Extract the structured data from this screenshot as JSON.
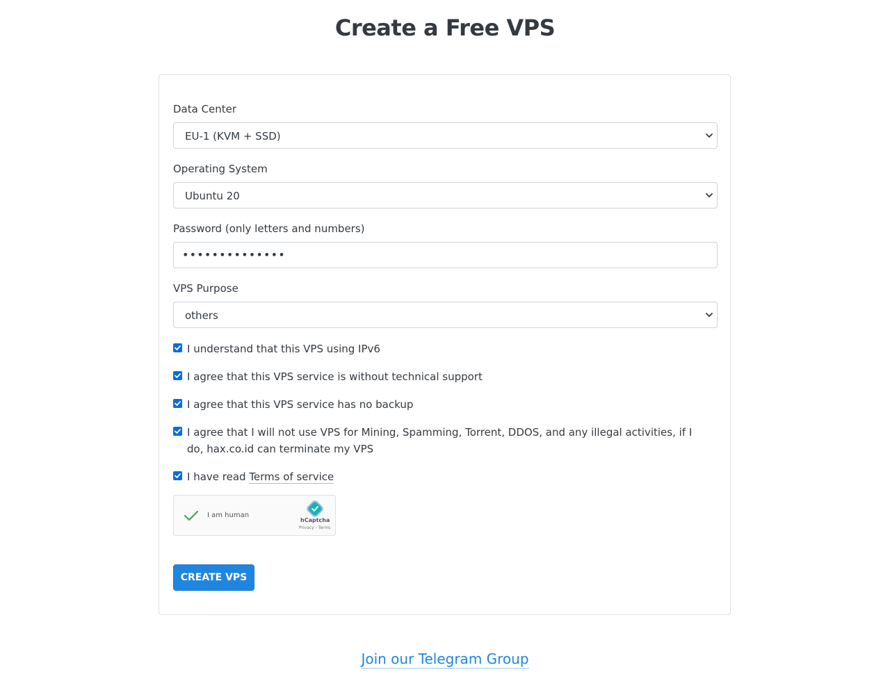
{
  "page": {
    "title": "Create a Free VPS"
  },
  "form": {
    "data_center": {
      "label": "Data Center",
      "selected": "EU-1 (KVM + SSD)"
    },
    "operating_system": {
      "label": "Operating System",
      "selected": "Ubuntu 20"
    },
    "password": {
      "label": "Password (only letters and numbers)",
      "masked_value": "••••••••••••••"
    },
    "purpose": {
      "label": "VPS Purpose",
      "selected": "others"
    },
    "agreements": [
      {
        "label": "I understand that this VPS using IPv6",
        "checked": true
      },
      {
        "label": "I agree that this VPS service is without technical support",
        "checked": true
      },
      {
        "label": "I agree that this VPS service has no backup",
        "checked": true
      },
      {
        "label": "I agree that I will not use VPS for Mining, Spamming, Torrent, DDOS, and any illegal activities, if I do, hax.co.id can terminate my VPS",
        "checked": true
      }
    ],
    "tos": {
      "prefix": "I have read ",
      "link_text": "Terms of service",
      "checked": true
    },
    "captcha": {
      "label": "I am human",
      "brand": "hCaptcha",
      "links": "Privacy - Terms",
      "icon": "hcaptcha-logo-icon"
    },
    "submit_label": "CREATE VPS"
  },
  "footer": {
    "telegram_link": "Join our Telegram Group"
  },
  "colors": {
    "accent": "#1f86e0",
    "checkbox": "#0b6ed8",
    "text": "#343a40",
    "border": "#ced4da"
  }
}
